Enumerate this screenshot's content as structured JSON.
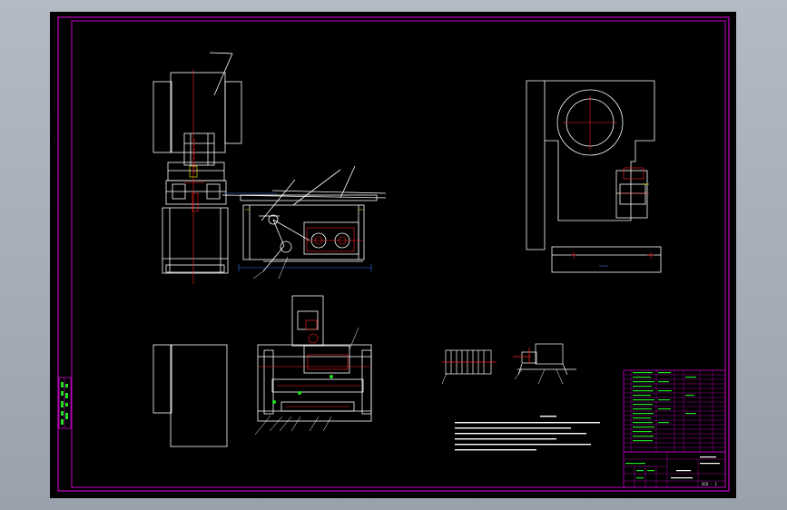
{
  "drawing": {
    "drawing_number": "SCU - 1",
    "colors": {
      "background": "#000000",
      "frame": "#c800c8",
      "outline": "#ffffff",
      "centerline": "#ff2020",
      "dimension": "#3c78ff",
      "annotation": "#20e020",
      "hidden": "#ffff00"
    },
    "views": [
      "front-view",
      "side-view",
      "top-view",
      "detail-view-spring",
      "detail-view-motor"
    ]
  }
}
